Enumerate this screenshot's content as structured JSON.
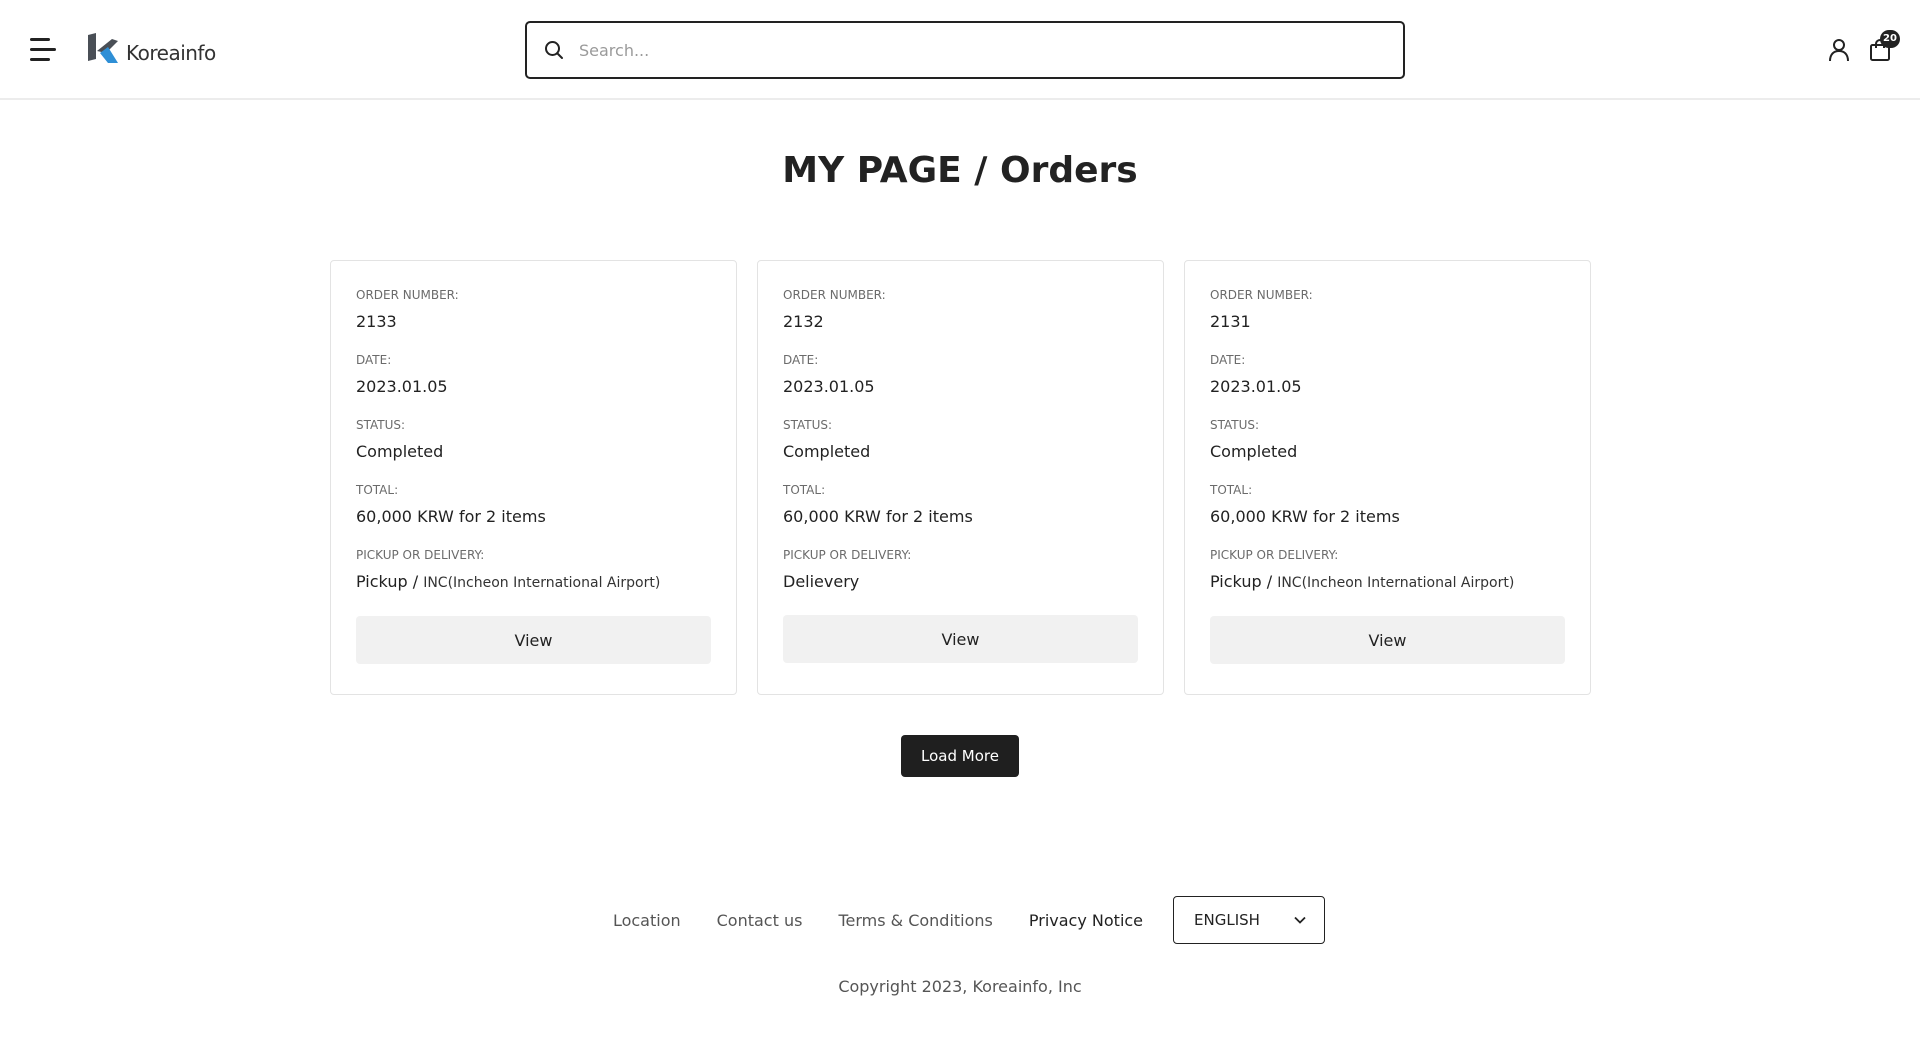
{
  "header": {
    "logo_text": "Koreainfo",
    "search": {
      "placeholder": "Search...",
      "value": ""
    },
    "cart_count": "20"
  },
  "page_title": "MY PAGE / Orders",
  "labels": {
    "order_number": "ORDER NUMBER:",
    "date": "DATE:",
    "status": "STATUS:",
    "total": "TOTAL:",
    "pickup_or_delivery": "PICKUP OR DELIVERY:"
  },
  "orders": [
    {
      "order_number": "2133",
      "date": "2023.01.05",
      "status": "Completed",
      "total": "60,000 KRW for 2 items",
      "method": "Pickup /",
      "location": "INC(Incheon International Airport)",
      "view_label": "View"
    },
    {
      "order_number": "2132",
      "date": "2023.01.05",
      "status": "Completed",
      "total": "60,000 KRW for 2 items",
      "method": "Delievery",
      "location": "",
      "view_label": "View"
    },
    {
      "order_number": "2131",
      "date": "2023.01.05",
      "status": "Completed",
      "total": "60,000 KRW for 2 items",
      "method": "Pickup /",
      "location": "INC(Incheon International Airport)",
      "view_label": "View"
    }
  ],
  "load_more_label": "Load More",
  "footer": {
    "links": [
      "Location",
      "Contact us",
      "Terms & Conditions",
      "Privacy Notice"
    ],
    "language": "ENGLISH",
    "copyright": "Copyright 2023, Koreainfo, Inc"
  },
  "colors": {
    "primary_dark": "#1f1f1f",
    "logo_gray": "#4a4f56",
    "logo_blue": "#2e8fd6",
    "button_light": "#f1f1f1"
  },
  "icons": {
    "menu": "hamburger-menu-icon",
    "search": "search-icon",
    "user": "user-icon",
    "cart": "shopping-bag-icon",
    "dropdown": "chevron-down-icon"
  }
}
